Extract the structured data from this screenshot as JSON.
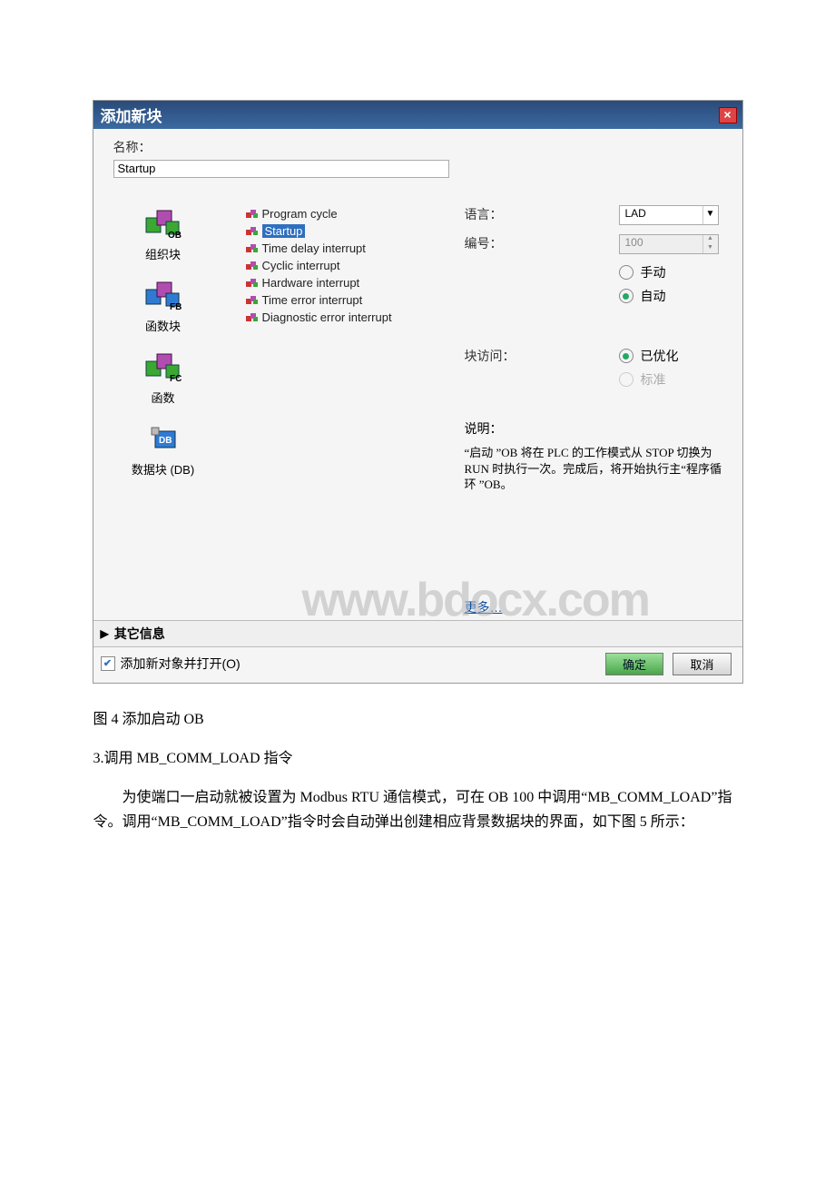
{
  "dialog": {
    "title": "添加新块",
    "close": "×",
    "name_label": "名称：",
    "name_value": "Startup",
    "tiles": [
      {
        "suffix": "OB",
        "caption": "组织块"
      },
      {
        "suffix": "FB",
        "caption": "函数块"
      },
      {
        "suffix": "FC",
        "caption": "函数"
      },
      {
        "suffix": "DB",
        "caption": "数据块 (DB)"
      }
    ],
    "ob_list": [
      {
        "label": "Program cycle",
        "sel": false
      },
      {
        "label": "Startup",
        "sel": true
      },
      {
        "label": "Time delay interrupt",
        "sel": false
      },
      {
        "label": "Cyclic interrupt",
        "sel": false
      },
      {
        "label": "Hardware interrupt",
        "sel": false
      },
      {
        "label": "Time error interrupt",
        "sel": false
      },
      {
        "label": "Diagnostic error interrupt",
        "sel": false
      }
    ],
    "right": {
      "lang_label": "语言：",
      "lang_value": "LAD",
      "num_label": "编号：",
      "num_value": "100",
      "mode_manual": "手动",
      "mode_auto": "自动",
      "access_label": "块访问：",
      "access_opt": "已优化",
      "access_std": "标准",
      "desc_label": "说明：",
      "desc_text": "“启动 ”OB 将在 PLC 的工作模式从 STOP 切换为 RUN 时执行一次。完成后，将开始执行主“程序循环 ”OB。",
      "more": "更多…"
    },
    "other_info": "其它信息",
    "add_open": "添加新对象并打开(O)",
    "ok": "确定",
    "cancel": "取消"
  },
  "watermark": "www.bdocx.com",
  "body": {
    "caption": "图 4 添加启动 OB",
    "step": "3.调用 MB_COMM_LOAD 指令",
    "para": "为使端口一启动就被设置为 Modbus RTU 通信模式，可在 OB 100 中调用“MB_COMM_LOAD”指令。调用“MB_COMM_LOAD”指令时会自动弹出创建相应背景数据块的界面，如下图 5 所示："
  }
}
